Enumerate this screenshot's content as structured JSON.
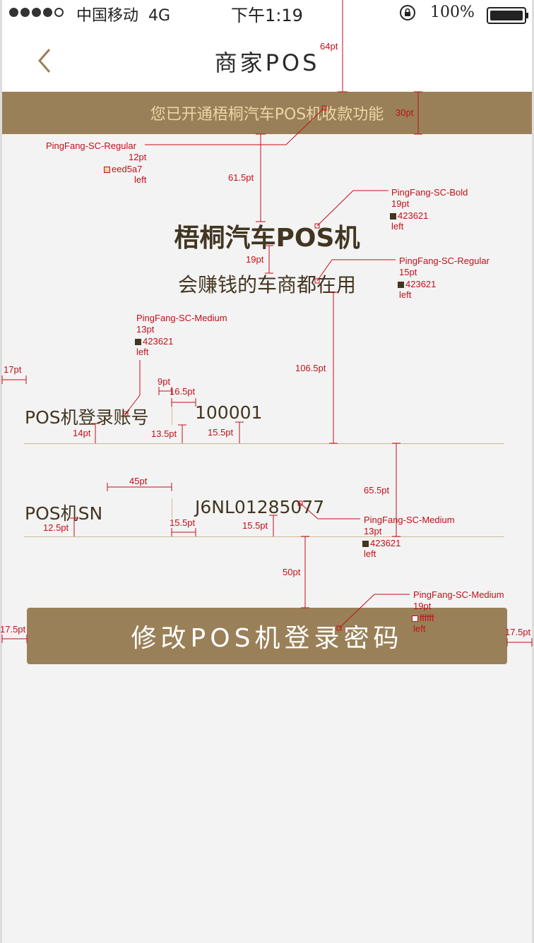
{
  "status_bar": {
    "carrier": "中国移动",
    "network": "4G",
    "time": "下午1:19",
    "battery": "100%"
  },
  "nav": {
    "title": "商家POS"
  },
  "banner": {
    "text": "您已开通梧桐汽车POS机收款功能"
  },
  "hero": {
    "title": "梧桐汽车POS机",
    "subtitle": "会赚钱的车商都在用"
  },
  "form": {
    "rows": [
      {
        "label": "POS机登录账号",
        "value": "100001"
      },
      {
        "label": "POS机SN",
        "value": "J6NL01285077"
      }
    ]
  },
  "button": {
    "label": "修改POS机登录密码"
  },
  "colors": {
    "brand": "#9a8058",
    "banner_text": "#eed5a7",
    "text": "#423621",
    "button_text": "#ffffff",
    "annotation": "#c0101a"
  },
  "annotations": {
    "banner_spec": {
      "font": "PingFang-SC-Regular",
      "size": "12pt",
      "color": "eed5a7",
      "align": "left"
    },
    "title_spec": {
      "font": "PingFang-SC-Bold",
      "size": "19pt",
      "color": "423621",
      "align": "left"
    },
    "subtitle_spec": {
      "font": "PingFang-SC-Regular",
      "size": "15pt",
      "color": "423621",
      "align": "left"
    },
    "label_spec": {
      "font": "PingFang-SC-Medium",
      "size": "13pt",
      "color": "423621",
      "align": "left"
    },
    "value_spec": {
      "font": "PingFang-SC-Medium",
      "size": "13pt",
      "color": "423621",
      "align": "left"
    },
    "button_spec": {
      "font": "PingFang-SC-Medium",
      "size": "19pt",
      "color": "ffffff",
      "align": "left"
    },
    "dims": {
      "nav_height": "64pt",
      "banner_height": "30pt",
      "banner_to_title": "61.5pt",
      "title_to_subtitle": "19pt",
      "subtitle_to_line": "106.5pt",
      "left_margin": "17pt",
      "divider_gap": "9pt",
      "value_offset": "16.5pt",
      "label_bottom": "14pt",
      "divider_bottom": "13.5pt",
      "value_bottom": "15.5pt",
      "row_height": "65.5pt",
      "sn_label_width": "45pt",
      "sn_label_bottom": "12.5pt",
      "sn_value_offset": "15.5pt",
      "sn_value_bottom": "15.5pt",
      "line_to_button": "50pt",
      "button_margin_left": "17.5pt",
      "button_margin_right": "17.5pt"
    }
  }
}
